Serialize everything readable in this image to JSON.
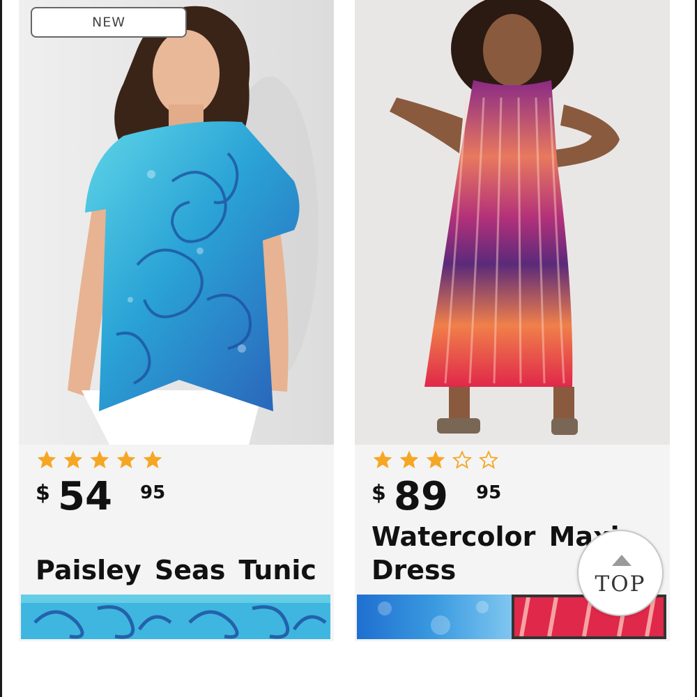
{
  "products": [
    {
      "badge": "NEW",
      "rating": 5,
      "price": {
        "currency": "$",
        "dollars": "54",
        "cents": "95"
      },
      "name": "Paisley Seas Tunic"
    },
    {
      "rating": 3,
      "price": {
        "currency": "$",
        "dollars": "89",
        "cents": "95"
      },
      "name": "Watercolor Maxi Dress"
    }
  ],
  "top_button": {
    "label": "TOP"
  },
  "colors": {
    "star_filled": "#F5A623",
    "text": "#111111",
    "card_bg": "#F4F4F4"
  },
  "icons": [
    "star-icon",
    "star-outline-icon",
    "arrow-up-icon"
  ]
}
